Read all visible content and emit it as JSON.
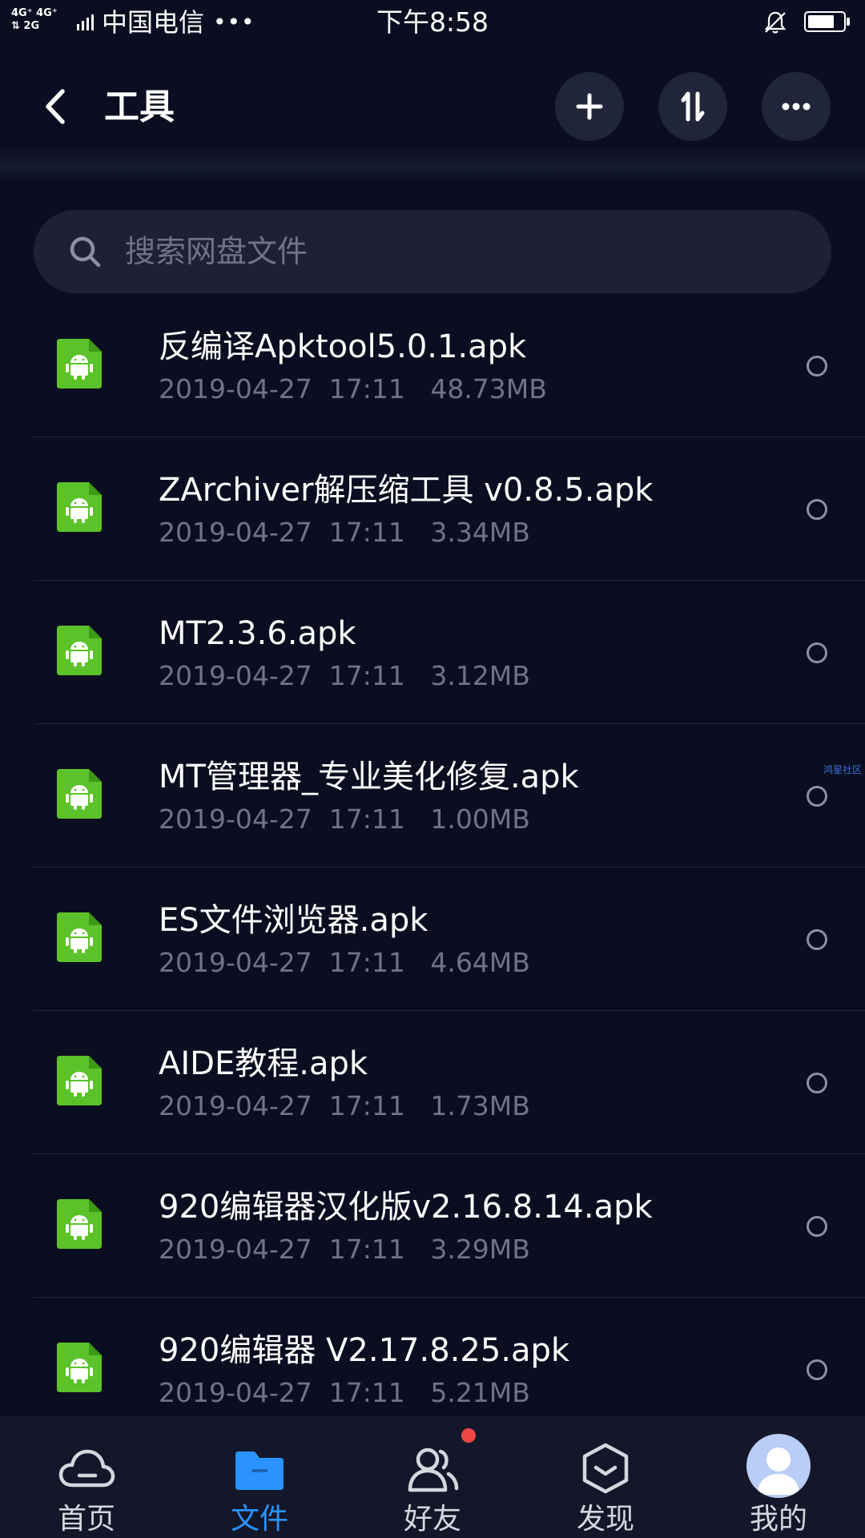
{
  "status_bar": {
    "network_top": "4G⁺ 4G⁺",
    "network_bottom": "⇅ 2G",
    "carrier": "中国电信",
    "more": "•••",
    "time": "下午8:58"
  },
  "header": {
    "title": "工具",
    "back_icon": "chevron-left-icon",
    "actions": [
      "plus-icon",
      "sort-icon",
      "more-icon"
    ]
  },
  "search": {
    "placeholder": "搜索网盘文件"
  },
  "files": [
    {
      "name": "反编译Apktool5.0.1.apk",
      "meta": "2019-04-27  17:11   48.73MB"
    },
    {
      "name": "ZArchiver解压缩工具 v0.8.5.apk",
      "meta": "2019-04-27  17:11   3.34MB"
    },
    {
      "name": "MT2.3.6.apk",
      "meta": "2019-04-27  17:11   3.12MB"
    },
    {
      "name": "MT管理器_专业美化修复.apk",
      "meta": "2019-04-27  17:11   1.00MB"
    },
    {
      "name": "ES文件浏览器.apk",
      "meta": "2019-04-27  17:11   4.64MB"
    },
    {
      "name": "AIDE教程.apk",
      "meta": "2019-04-27  17:11   1.73MB"
    },
    {
      "name": "920编辑器汉化版v2.16.8.14.apk",
      "meta": "2019-04-27  17:11   3.29MB"
    },
    {
      "name": "920编辑器 V2.17.8.25.apk",
      "meta": "2019-04-27  17:11   5.21MB"
    }
  ],
  "watermark": "鸿星社区",
  "bottom_nav": {
    "items": [
      {
        "label": "首页",
        "icon": "cloud-icon"
      },
      {
        "label": "文件",
        "icon": "folder-icon",
        "active": true
      },
      {
        "label": "好友",
        "icon": "friends-icon",
        "badge": true
      },
      {
        "label": "发现",
        "icon": "discover-icon"
      },
      {
        "label": "我的",
        "icon": "avatar-icon"
      }
    ]
  },
  "colors": {
    "background": "#0b0e20",
    "accent": "#2a93ff",
    "apk_icon": "#5cc22a",
    "badge": "#f04848"
  }
}
